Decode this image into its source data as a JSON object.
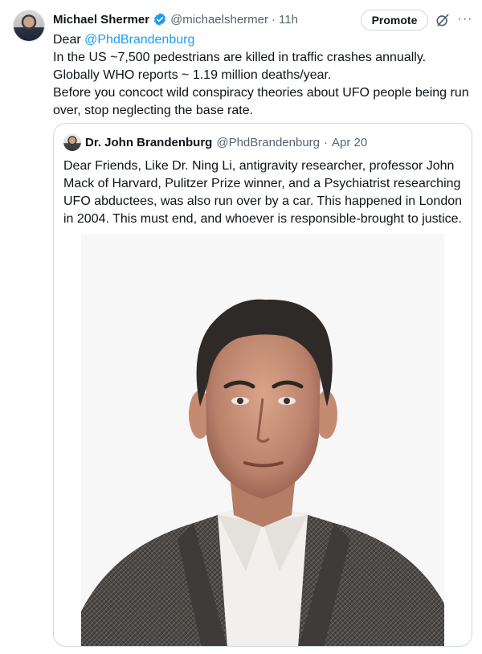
{
  "tweet": {
    "author_name": "Michael Shermer",
    "handle": "@michaelshermer",
    "separator": "·",
    "time": "11h",
    "promote_label": "Promote",
    "more_label": "···",
    "greeting_prefix": "Dear ",
    "greeting_mention": "@PhdBrandenburg",
    "line1": "In the US ~7,500 pedestrians are killed in traffic crashes annually. Globally WHO reports ~ 1.19 million deaths/year.",
    "line2": "Before you concoct wild conspiracy theories about UFO people being run over, stop neglecting the base rate."
  },
  "quoted": {
    "author_name": "Dr. John Brandenburg",
    "handle": "@PhdBrandenburg",
    "separator": "·",
    "time": "Apr 20",
    "text": "Dear Friends, Like Dr. Ning Li, antigravity researcher, professor John Mack of Harvard, Pulitzer Prize winner, and  a Psychiatrist researching UFO abductees, was also run over by a car. This happened in London in 2004. This must end, and whoever is responsible-brought to justice."
  },
  "icons": {
    "verified": "verified-badge-icon",
    "grok": "grok-icon",
    "more": "more-options-icon"
  },
  "colors": {
    "link": "#1d9bf0",
    "verified": "#1d9bf0",
    "secondary_text": "#536471",
    "border": "#cfd9de"
  }
}
